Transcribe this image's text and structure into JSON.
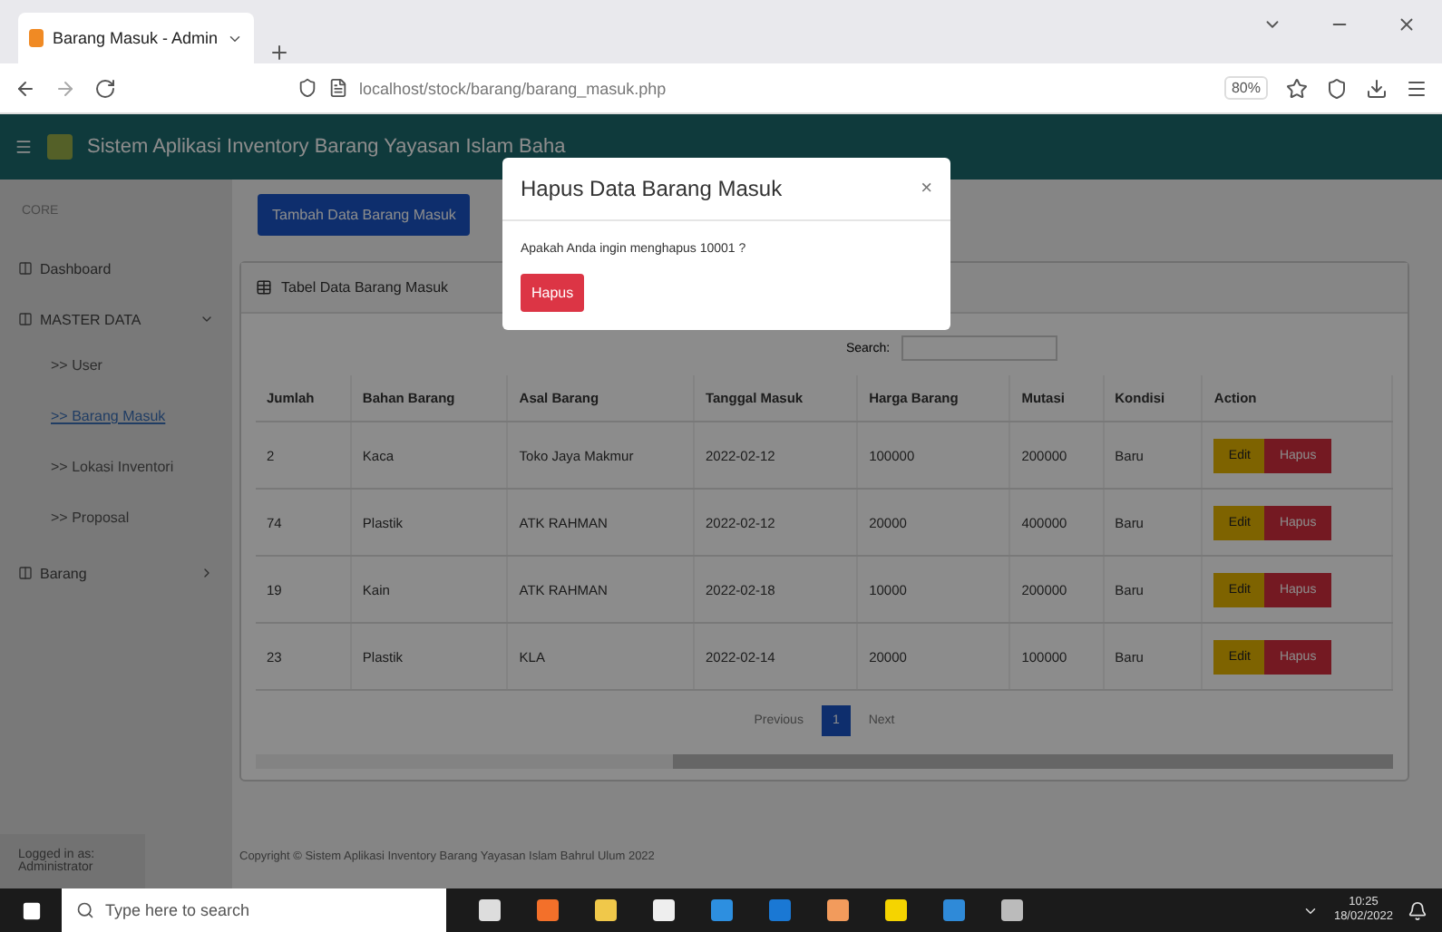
{
  "browser": {
    "tab_title": "Barang Masuk - Admin",
    "url": "localhost/stock/barang/barang_masuk.php",
    "zoom": "80%"
  },
  "app": {
    "title": "Sistem Aplikasi Inventory Barang Yayasan Islam Baha"
  },
  "sidebar": {
    "heading": "CORE",
    "items": [
      {
        "label": "Dashboard"
      },
      {
        "label": "MASTER DATA",
        "expanded": true,
        "children": [
          {
            "label": ">> User",
            "selected": false
          },
          {
            "label": ">> Barang Masuk",
            "selected": true
          },
          {
            "label": ">> Lokasi Inventori",
            "selected": false
          },
          {
            "label": ">> Proposal",
            "selected": false
          }
        ]
      },
      {
        "label": "Barang",
        "expanded": false
      }
    ],
    "footer": "Logged in as: Administrator"
  },
  "add_button": "Tambah Data Barang Masuk",
  "card": {
    "title": "Tabel Data Barang Masuk",
    "search_label": "Search:",
    "columns": [
      "Jumlah",
      "Bahan Barang",
      "Asal Barang",
      "Tanggal Masuk",
      "Harga Barang",
      "Mutasi",
      "Kondisi",
      "Action"
    ],
    "rows": [
      {
        "cells": [
          "2",
          "Kaca",
          "Toko Jaya Makmur",
          "2022-02-12",
          "100000",
          "200000",
          "Baru"
        ],
        "actions": [
          {
            "label": "Edit",
            "kind": "edit"
          },
          {
            "label": "Hapus",
            "kind": "delete"
          }
        ]
      },
      {
        "cells": [
          "74",
          "Plastik",
          "ATK RAHMAN",
          "2022-02-12",
          "20000",
          "400000",
          "Baru"
        ],
        "actions": [
          {
            "label": "Edit",
            "kind": "edit"
          },
          {
            "label": "Hapus",
            "kind": "delete"
          }
        ]
      },
      {
        "cells": [
          "19",
          "Kain",
          "ATK RAHMAN",
          "2022-02-18",
          "10000",
          "200000",
          "Baru"
        ],
        "actions": [
          {
            "label": "Edit",
            "kind": "edit"
          },
          {
            "label": "Hapus",
            "kind": "delete"
          }
        ]
      },
      {
        "cells": [
          "23",
          "Plastik",
          "KLA",
          "2022-02-14",
          "20000",
          "100000",
          "Baru"
        ],
        "actions": [
          {
            "label": "Edit",
            "kind": "edit"
          },
          {
            "label": "Hapus",
            "kind": "delete"
          }
        ]
      }
    ],
    "pagination": {
      "previous": "Previous",
      "pages": [
        {
          "label": "1",
          "selected": true
        }
      ],
      "next": "Next"
    }
  },
  "footer": "Copyright © Sistem Aplikasi Inventory Barang Yayasan Islam Bahrul Ulum 2022",
  "modal": {
    "title": "Hapus Data Barang Masuk",
    "close": "×",
    "message": "Apakah Anda ingin menghapus 10001 ?",
    "confirm": "Hapus"
  },
  "taskbar": {
    "search_placeholder": "Type here to search",
    "time": "10:25",
    "date": "18/02/2022"
  }
}
